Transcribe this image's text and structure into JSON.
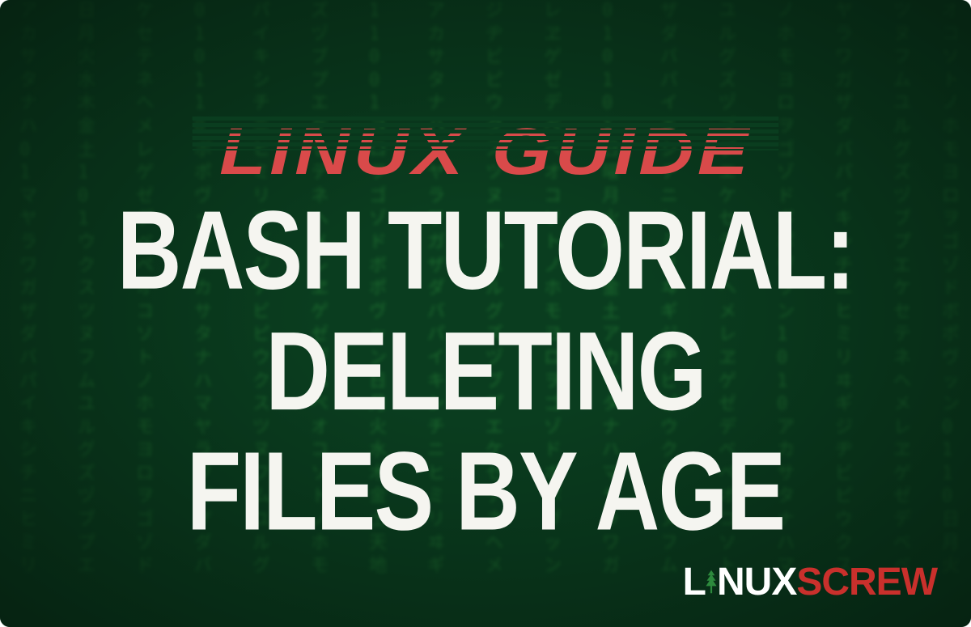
{
  "eyebrow": "LINUX GUIDE",
  "title_line1": "BASH TUTORIAL:",
  "title_line2": "DELETING",
  "title_line3": "FILES BY AGE",
  "logo": {
    "part1": "L",
    "part2": "NUX",
    "part3": "SCREW"
  },
  "colors": {
    "background": "#0a3d1f",
    "eyebrow": "#d94a4a",
    "title": "#f5f5f0",
    "logo_accent": "#c9302c",
    "matrix": "#3dbd4a"
  }
}
